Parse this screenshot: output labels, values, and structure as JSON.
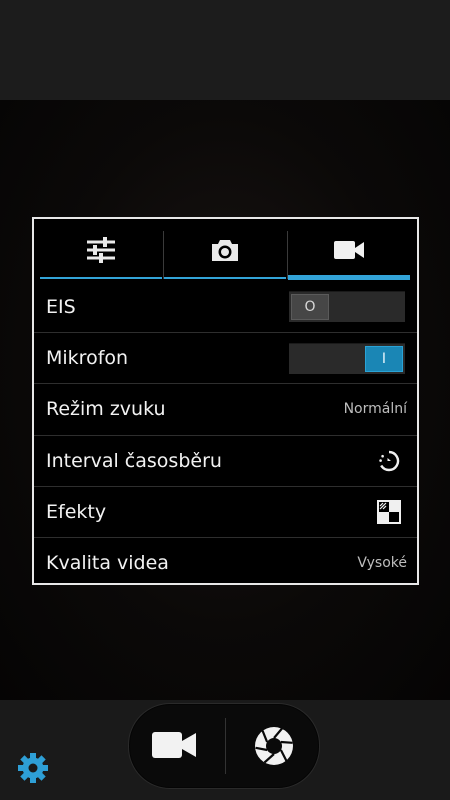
{
  "panel": {
    "tabs": [
      {
        "icon": "sliders-icon",
        "active": false
      },
      {
        "icon": "camera-icon",
        "active": false
      },
      {
        "icon": "video-camera-icon",
        "active": true
      }
    ],
    "rows": [
      {
        "label": "EIS",
        "control": "toggle",
        "state": "off",
        "toggle_text": "O"
      },
      {
        "label": "Mikrofon",
        "control": "toggle",
        "state": "on",
        "toggle_text": "I"
      },
      {
        "label": "Režim zvuku",
        "control": "value",
        "value": "Normální"
      },
      {
        "label": "Interval časosběru",
        "control": "icon",
        "icon": "timer-icon"
      },
      {
        "label": "Efekty",
        "control": "icon",
        "icon": "effects-icon"
      },
      {
        "label": "Kvalita videa",
        "control": "value",
        "value": "Vysoké"
      }
    ]
  },
  "bottom": {
    "left_icon": "gear-icon",
    "video_button_icon": "video-camera-icon",
    "shutter_button_icon": "aperture-icon"
  },
  "colors": {
    "accent": "#33a4d8",
    "toggle_on": "#1a86b5",
    "settings_icon": "#2e9fd6"
  }
}
